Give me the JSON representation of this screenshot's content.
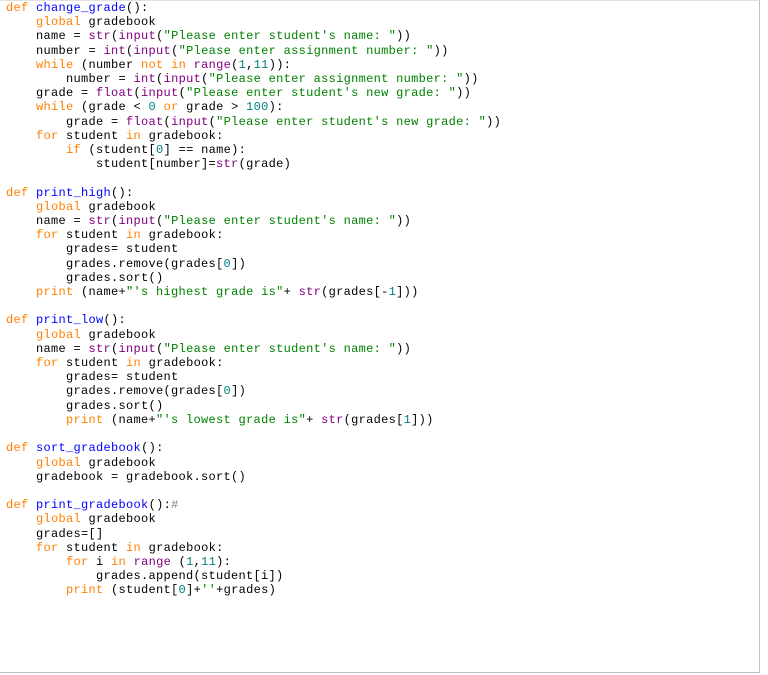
{
  "l1_def": "def",
  "l1_fn": "change_grade",
  "l1_rest": "():",
  "l2_kw": "global",
  "l2_rest": " gradebook",
  "l3a": "    name = ",
  "l3b": "str",
  "l3c": "(",
  "l3d": "input",
  "l3e": "(",
  "l3f": "\"Please enter student's name: \"",
  "l3g": ")",
  "l4a": "    number = ",
  "l4b": "int",
  "l4c": "(",
  "l4d": "input",
  "l4e": "(",
  "l4f": "\"Please enter assignment number: \"",
  "l4g": ")",
  "l5a": "while",
  "l5b": " (number ",
  "l5c": "not",
  "l5d": " ",
  "l5e": "in",
  "l5f": " ",
  "l5g": "range",
  "l5h": "(",
  "l5i": "1",
  "l5j": ",",
  "l5k": "11",
  "l5l": ")):",
  "l6a": "        number = ",
  "l6b": "int",
  "l6c": "(",
  "l6d": "input",
  "l6e": "(",
  "l6f": "\"Please enter assignment number: \"",
  "l6g": ")",
  "l7a": "    grade = ",
  "l7b": "float",
  "l7c": "(",
  "l7d": "input",
  "l7e": "(",
  "l7f": "\"Please enter student's new grade: \"",
  "l7g": ")",
  "l8a": "while",
  "l8b": " (grade < ",
  "l8c": "0",
  "l8d": " ",
  "l8e": "or",
  "l8f": " grade > ",
  "l8g": "100",
  "l8h": "):",
  "l9a": "        grade = ",
  "l9b": "float",
  "l9c": "(",
  "l9d": "input",
  "l9e": "(",
  "l9f": "\"Please enter student's new grade: \"",
  "l9g": ")",
  "l10a": "for",
  "l10b": " student ",
  "l10c": "in",
  "l10d": " gradebook:",
  "l11a": "if",
  "l11b": " (student[",
  "l11c": "0",
  "l11d": "] == name):",
  "l12a": "            student[number]=",
  "l12b": "str",
  "l12c": "(grade)",
  "l13": "",
  "l14a": "def",
  "l14b": "print_high",
  "l14c": "():",
  "l15a": "global",
  "l15b": " gradebook",
  "l16a": "    name = ",
  "l16b": "str",
  "l16c": "(",
  "l16d": "input",
  "l16e": "(",
  "l16f": "\"Please enter student's name: \"",
  "l16g": ")",
  "l17a": "for",
  "l17b": " student ",
  "l17c": "in",
  "l17d": " gradebook:",
  "l18": "        grades= student",
  "l19a": "        grades.remove(grades[",
  "l19b": "0",
  "l19c": "])",
  "l20": "        grades.sort()",
  "l21a": "print",
  "l21b": " (name+",
  "l21c": "\"'s highest grade is\"",
  "l21d": "+ ",
  "l21e": "str",
  "l21f": "(grades[-",
  "l21g": "1",
  "l21h": "]))",
  "l22": "",
  "l23a": "def",
  "l23b": "print_low",
  "l23c": "():",
  "l24a": "global",
  "l24b": " gradebook",
  "l25a": "    name = ",
  "l25b": "str",
  "l25c": "(",
  "l25d": "input",
  "l25e": "(",
  "l25f": "\"Please enter student's name: \"",
  "l25g": ")",
  "l26a": "for",
  "l26b": " student ",
  "l26c": "in",
  "l26d": " gradebook:",
  "l27": "        grades= student",
  "l28a": "        grades.remove(grades[",
  "l28b": "0",
  "l28c": "])",
  "l29": "        grades.sort()",
  "l30a": "print",
  "l30b": " (name+",
  "l30c": "\"'s lowest grade is\"",
  "l30d": "+ ",
  "l30e": "str",
  "l30f": "(grades[",
  "l30g": "1",
  "l30h": "]))",
  "l31": "",
  "l32a": "def",
  "l32b": "sort_gradebook",
  "l32c": "():",
  "l33a": "global",
  "l33b": " gradebook",
  "l34": "    gradebook = gradebook.sort()",
  "l35": "",
  "l36a": "def",
  "l36b": "print_gradebook",
  "l36c": "():",
  "l36d": "#",
  "l37a": "global",
  "l37b": " gradebook",
  "l38": "    grades=[]",
  "l39a": "for",
  "l39b": " student ",
  "l39c": "in",
  "l39d": " gradebook:",
  "l40a": "for",
  "l40b": " i ",
  "l40c": "in",
  "l40d": " ",
  "l40e": "range",
  "l40f": " (",
  "l40g": "1",
  "l40h": ",",
  "l40i": "11",
  "l40j": "):",
  "l41": "            grades.append(student[i])",
  "l42a": "print",
  "l42b": " (student[",
  "l42c": "0",
  "l42d": "]+",
  "l42e": "''",
  "l42f": "+grades)"
}
